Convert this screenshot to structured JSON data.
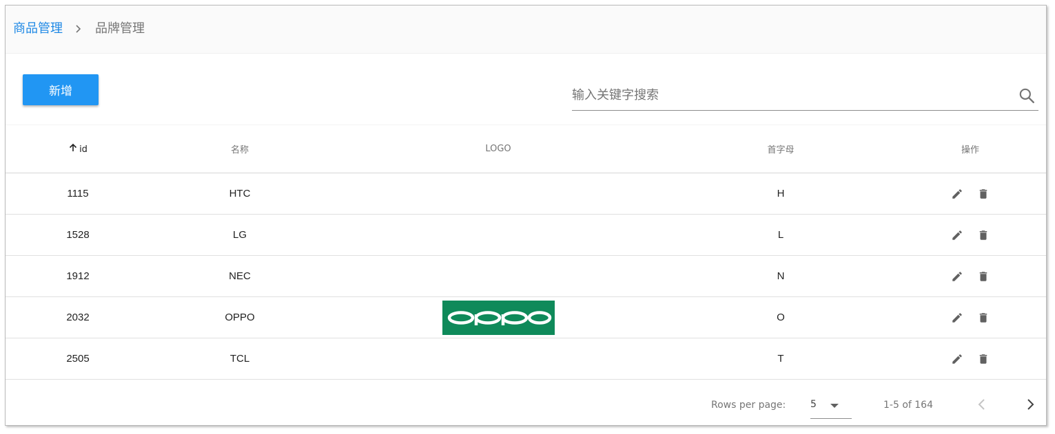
{
  "breadcrumb": {
    "parent": "商品管理",
    "separator_icon": "chevron-right-icon",
    "current": "品牌管理"
  },
  "toolbar": {
    "add_label": "新增",
    "search_placeholder": "输入关键字搜索",
    "search_value": "",
    "search_icon": "search-icon"
  },
  "table": {
    "columns": [
      {
        "key": "id",
        "label": "id",
        "sorted": "asc"
      },
      {
        "key": "name",
        "label": "名称"
      },
      {
        "key": "logo",
        "label": "LOGO"
      },
      {
        "key": "letter",
        "label": "首字母"
      },
      {
        "key": "actions",
        "label": "操作"
      }
    ],
    "rows": [
      {
        "id": "1115",
        "name": "HTC",
        "logo": "",
        "letter": "H"
      },
      {
        "id": "1528",
        "name": "LG",
        "logo": "",
        "letter": "L"
      },
      {
        "id": "1912",
        "name": "NEC",
        "logo": "",
        "letter": "N"
      },
      {
        "id": "2032",
        "name": "OPPO",
        "logo": "OPPO",
        "letter": "O"
      },
      {
        "id": "2505",
        "name": "TCL",
        "logo": "",
        "letter": "T"
      }
    ],
    "row_actions": [
      "edit-icon",
      "delete-icon"
    ]
  },
  "pagination": {
    "rows_per_page_label": "Rows per page:",
    "rows_per_page_value": "5",
    "range_text": "1-5 of 164",
    "prev_icon": "chevron-left-icon",
    "next_icon": "chevron-right-icon"
  },
  "colors": {
    "accent": "#2196f3",
    "link": "#1e88e5",
    "oppo_logo_bg": "#0f8a5a"
  }
}
